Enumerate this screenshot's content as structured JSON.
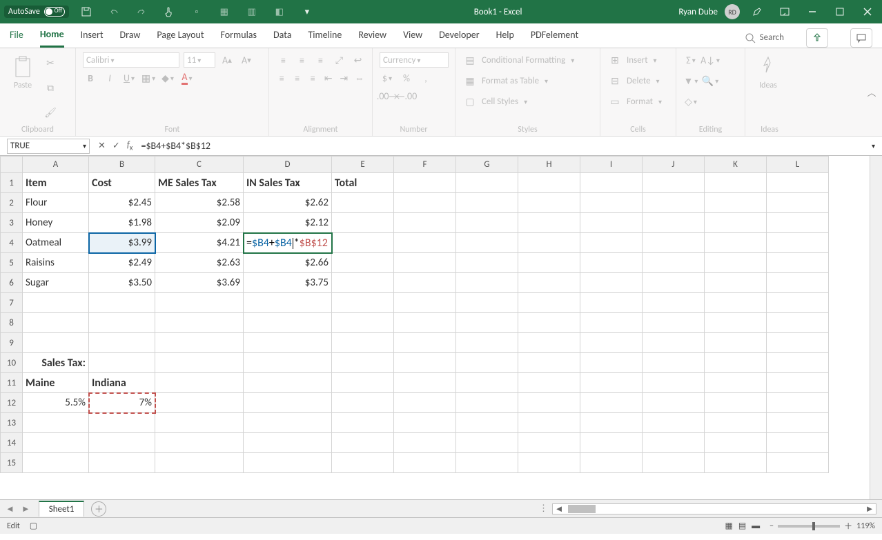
{
  "titlebar": {
    "autosave_label": "AutoSave",
    "autosave_state": "Off",
    "title": "Book1  -  Excel",
    "user": "Ryan Dube",
    "initials": "RD"
  },
  "tabs": {
    "items": [
      "File",
      "Home",
      "Insert",
      "Draw",
      "Page Layout",
      "Formulas",
      "Data",
      "Timeline",
      "Review",
      "View",
      "Developer",
      "Help",
      "PDFelement"
    ],
    "active": "Home",
    "search": "Search"
  },
  "ribbon": {
    "clipboard": {
      "paste": "Paste",
      "label": "Clipboard"
    },
    "font": {
      "name": "Calibri",
      "size": "11",
      "label": "Font"
    },
    "alignment": {
      "label": "Alignment"
    },
    "number": {
      "format": "Currency",
      "label": "Number"
    },
    "styles": {
      "cond": "Conditional Formatting",
      "table": "Format as Table",
      "cell": "Cell Styles",
      "label": "Styles"
    },
    "cells": {
      "insert": "Insert",
      "delete": "Delete",
      "format": "Format",
      "label": "Cells"
    },
    "editing": {
      "label": "Editing"
    },
    "ideas": {
      "btn": "Ideas",
      "label": "Ideas"
    }
  },
  "formula_bar": {
    "namebox": "TRUE",
    "formula": "=$B4+$B4*$B$12"
  },
  "grid": {
    "cols": [
      "A",
      "B",
      "C",
      "D",
      "E",
      "F",
      "G",
      "H",
      "I",
      "J",
      "K",
      "L"
    ],
    "row_count": 15,
    "active_cell": "D4",
    "blue_ref": "B4",
    "red_ref": "B12",
    "data": {
      "1": {
        "A": "Item",
        "B": "Cost",
        "C": "ME Sales Tax",
        "D": "IN Sales Tax",
        "E": "Total"
      },
      "2": {
        "A": "Flour",
        "B": "$2.45",
        "C": "$2.58",
        "D": "$2.62"
      },
      "3": {
        "A": "Honey",
        "B": "$1.98",
        "C": "$2.09",
        "D": "$2.12"
      },
      "4": {
        "A": "Oatmeal",
        "B": "$3.99",
        "C": "$4.21"
      },
      "5": {
        "A": "Raisins",
        "B": "$2.49",
        "C": "$2.63",
        "D": "$2.66"
      },
      "6": {
        "A": "Sugar",
        "B": "$3.50",
        "C": "$3.69",
        "D": "$3.75"
      },
      "10": {
        "A": "Sales Tax:"
      },
      "11": {
        "A": "Maine",
        "B": "Indiana"
      },
      "12": {
        "A": "5.5%",
        "B": "7%"
      }
    },
    "formula_disp": {
      "eq": "=",
      "p1": "$B4",
      "plus": "+",
      "p2": "$B4",
      "star": "*",
      "p3": "$B$12"
    }
  },
  "sheets": {
    "active": "Sheet1"
  },
  "status": {
    "mode": "Edit",
    "zoom": "119%"
  }
}
